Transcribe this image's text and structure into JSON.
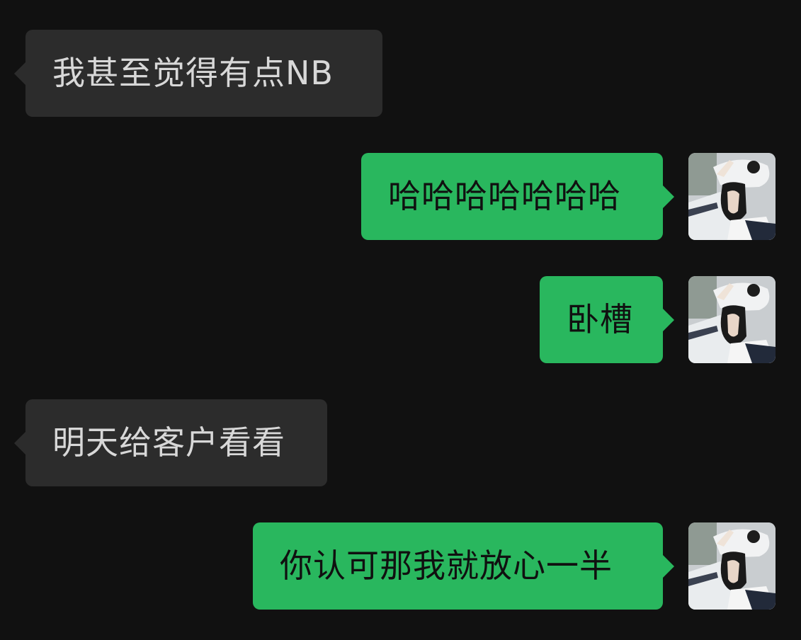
{
  "messages": [
    {
      "direction": "incoming",
      "text": "我甚至觉得有点NB"
    },
    {
      "direction": "outgoing",
      "text": "哈哈哈哈哈哈哈"
    },
    {
      "direction": "outgoing",
      "text": "卧槽"
    },
    {
      "direction": "incoming",
      "text": "明天给客户看看"
    },
    {
      "direction": "outgoing",
      "text": "你认可那我就放心一半"
    }
  ],
  "colors": {
    "background": "#111111",
    "incoming_bubble": "#2c2c2c",
    "incoming_text": "#d8d8d8",
    "outgoing_bubble": "#29b75e",
    "outgoing_text": "#101010"
  },
  "avatar": {
    "icon": "user-avatar-photo"
  }
}
